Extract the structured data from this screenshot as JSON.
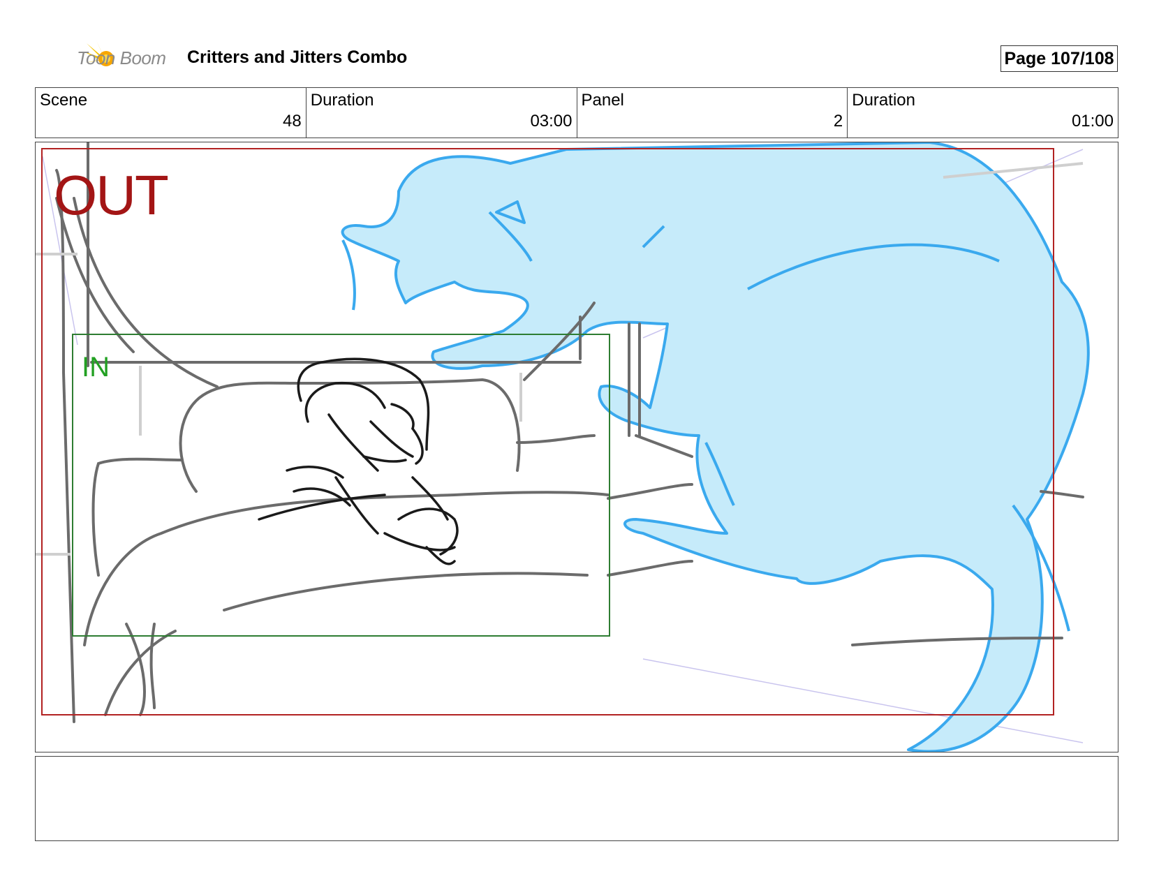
{
  "header": {
    "logo_text": "Toon Boom",
    "title": "Critters and Jitters Combo",
    "page_label": "Page 107/108"
  },
  "info": {
    "scene_label": "Scene",
    "scene_value": "48",
    "scene_duration_label": "Duration",
    "scene_duration_value": "03:00",
    "panel_label": "Panel",
    "panel_value": "2",
    "panel_duration_label": "Duration",
    "panel_duration_value": "01:00"
  },
  "panel": {
    "out_label": "OUT",
    "in_label": "IN"
  },
  "colors": {
    "out_frame": "#b22222",
    "in_frame": "#2e7d32",
    "creature_fill": "#c6ebfa",
    "creature_stroke": "#3aa9ee",
    "sketch_grey": "#6b6b6b"
  }
}
